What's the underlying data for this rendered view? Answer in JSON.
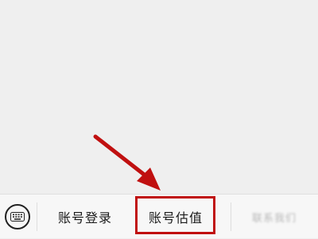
{
  "bottom_menu": {
    "items": [
      {
        "label": "账号登录"
      },
      {
        "label": "账号估值"
      },
      {
        "label": "联系我们"
      }
    ]
  },
  "icons": {
    "keyboard": "keyboard-icon",
    "arrow": "arrow-annotation-icon"
  },
  "colors": {
    "annotation_red": "#c01010",
    "background": "#efefef",
    "menu_bar": "#f7f7f7"
  }
}
